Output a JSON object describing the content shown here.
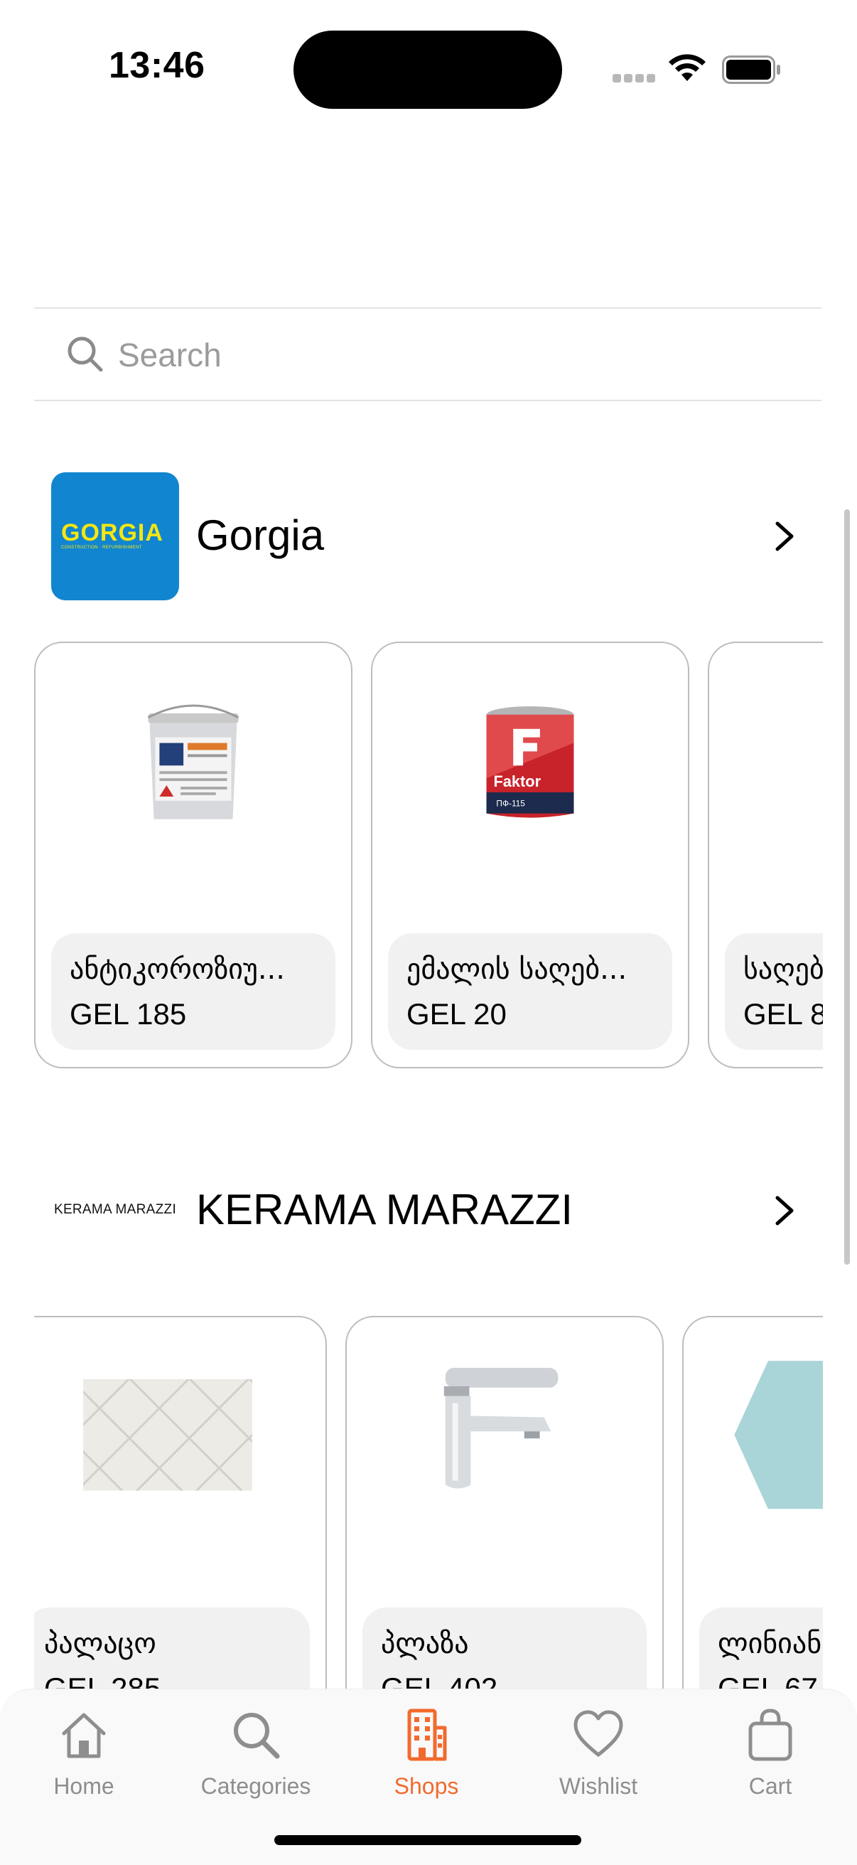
{
  "status_bar": {
    "time": "13:46"
  },
  "search": {
    "placeholder": "Search"
  },
  "shops": [
    {
      "name": "Gorgia",
      "logo_text": "GORGIA",
      "logo_subtext": "CONSTRUCTION · REFURBISHMENT",
      "products": [
        {
          "title": "ანტიკოროზიუ...",
          "price": "GEL 185"
        },
        {
          "title": "ემალის საღებ...",
          "price": "GEL 20"
        },
        {
          "title": "საღებ",
          "price": "GEL 8"
        }
      ]
    },
    {
      "name": "KERAMA MARAZZI",
      "logo_text": "KERAMA MARAZZI",
      "products": [
        {
          "title": "პალაცო",
          "price": "GEL 285"
        },
        {
          "title": "პლაზა",
          "price": "GEL 402"
        },
        {
          "title": "ლინიან",
          "price": "GEL 67"
        }
      ]
    }
  ],
  "tab_bar": {
    "items": [
      {
        "label": "Home",
        "icon": "house-icon"
      },
      {
        "label": "Categories",
        "icon": "search-icon"
      },
      {
        "label": "Shops",
        "icon": "building-icon",
        "active": true
      },
      {
        "label": "Wishlist",
        "icon": "heart-icon"
      },
      {
        "label": "Cart",
        "icon": "bag-icon"
      }
    ]
  },
  "colors": {
    "accent": "#f26a2e",
    "gorgia_blue": "#1185cf",
    "gorgia_yellow": "#f5e612"
  }
}
